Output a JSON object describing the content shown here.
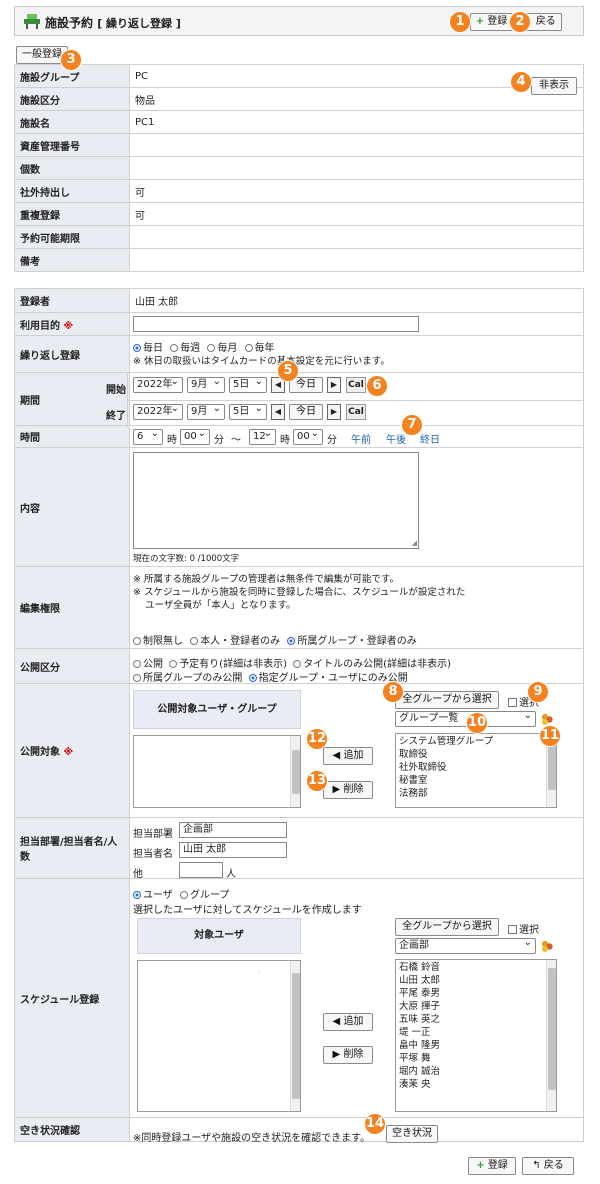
{
  "header": {
    "title": "施設予約",
    "subtitle": "[ 繰り返し登録 ]",
    "register": "登録",
    "back": "戻る"
  },
  "general_register": "一般登録",
  "hide_button": "非表示",
  "facility_rows": [
    {
      "label": "施設グループ",
      "value": "PC"
    },
    {
      "label": "施設区分",
      "value": "物品"
    },
    {
      "label": "施設名",
      "value": "PC1"
    },
    {
      "label": "資産管理番号",
      "value": ""
    },
    {
      "label": "個数",
      "value": ""
    },
    {
      "label": "社外持出し",
      "value": "可"
    },
    {
      "label": "重複登録",
      "value": "可"
    },
    {
      "label": "予約可能期限",
      "value": ""
    },
    {
      "label": "備考",
      "value": ""
    }
  ],
  "form": {
    "registrant_label": "登録者",
    "registrant": "山田 太郎",
    "purpose_label": "利用目的",
    "required": "※",
    "repeat_label": "繰り返し登録",
    "repeat_options": [
      "毎日",
      "毎週",
      "毎月",
      "毎年"
    ],
    "repeat_note": "※ 休日の取扱いはタイムカードの基本設定を元に行います。",
    "period_label": "期間",
    "start_label": "開始",
    "end_label": "終了",
    "year": "2022年",
    "month": "9月",
    "day": "5日",
    "today": "今日",
    "cal": "Cal",
    "time_label": "時間",
    "start_hour": "6",
    "start_min": "00",
    "end_hour": "12",
    "end_min": "00",
    "hour_unit": "時",
    "min_unit": "分",
    "tilde": "～",
    "am": "午前",
    "pm": "午後",
    "allday": "終日",
    "content_label": "内容",
    "char_count": "現在の文字数: 0 /1000文字",
    "edit_label": "編集権限",
    "edit_note1": "※ 所属する施設グループの管理者は無条件で編集が可能です。",
    "edit_note2": "※ スケジュールから施設を同時に登録した場合に、スケジュールが設定された",
    "edit_note3": "ユーザ全員が「本人」となります。",
    "edit_options": [
      "制限無し",
      "本人・登録者のみ",
      "所属グループ・登録者のみ"
    ],
    "public_label": "公開区分",
    "public_options_row1": [
      "公開",
      "予定有り(詳細は非表示)",
      "タイトルのみ公開(詳細は非表示)"
    ],
    "public_options_row2": [
      "所属グループのみ公開",
      "指定グループ・ユーザにのみ公開"
    ],
    "target_label": "公開対象",
    "target_box": "公開対象ユーザ・グループ",
    "select_all_groups": "全グループから選択",
    "select": "選択",
    "group_list": "グループ一覧",
    "groups": [
      "システム管理グループ",
      "取締役",
      "社外取締役",
      "秘書室",
      "法務部"
    ],
    "add": "追加",
    "remove": "削除",
    "dept_label": "担当部署/担当者名/人数",
    "dept_field": "担当部署",
    "dept_value": "企画部",
    "person_field": "担当者名",
    "person_value": "山田 太郎",
    "other": "他",
    "person_unit": "人",
    "schedule_label": "スケジュール登録",
    "sched_options": [
      "ユーザ",
      "グループ"
    ],
    "sched_note": "選択したユーザに対してスケジュールを作成します",
    "target_user": "対象ユーザ",
    "sched_group": "企画部",
    "users": [
      "石橋 鈴音",
      "山田 太郎",
      "平尾 泰男",
      "大原 揮子",
      "五味 英之",
      "堤 一正",
      "畠中 隆男",
      "平塚 舞",
      "堀内 誠治",
      "湊茉 央"
    ],
    "avail_label": "空き状況確認",
    "avail_note": "※同時登録ユーザや施設の空き状況を確認できます。",
    "avail_button": "空き状況"
  },
  "callouts": [
    "1",
    "2",
    "3",
    "4",
    "5",
    "6",
    "7",
    "8",
    "9",
    "10",
    "11",
    "12",
    "13",
    "14"
  ]
}
